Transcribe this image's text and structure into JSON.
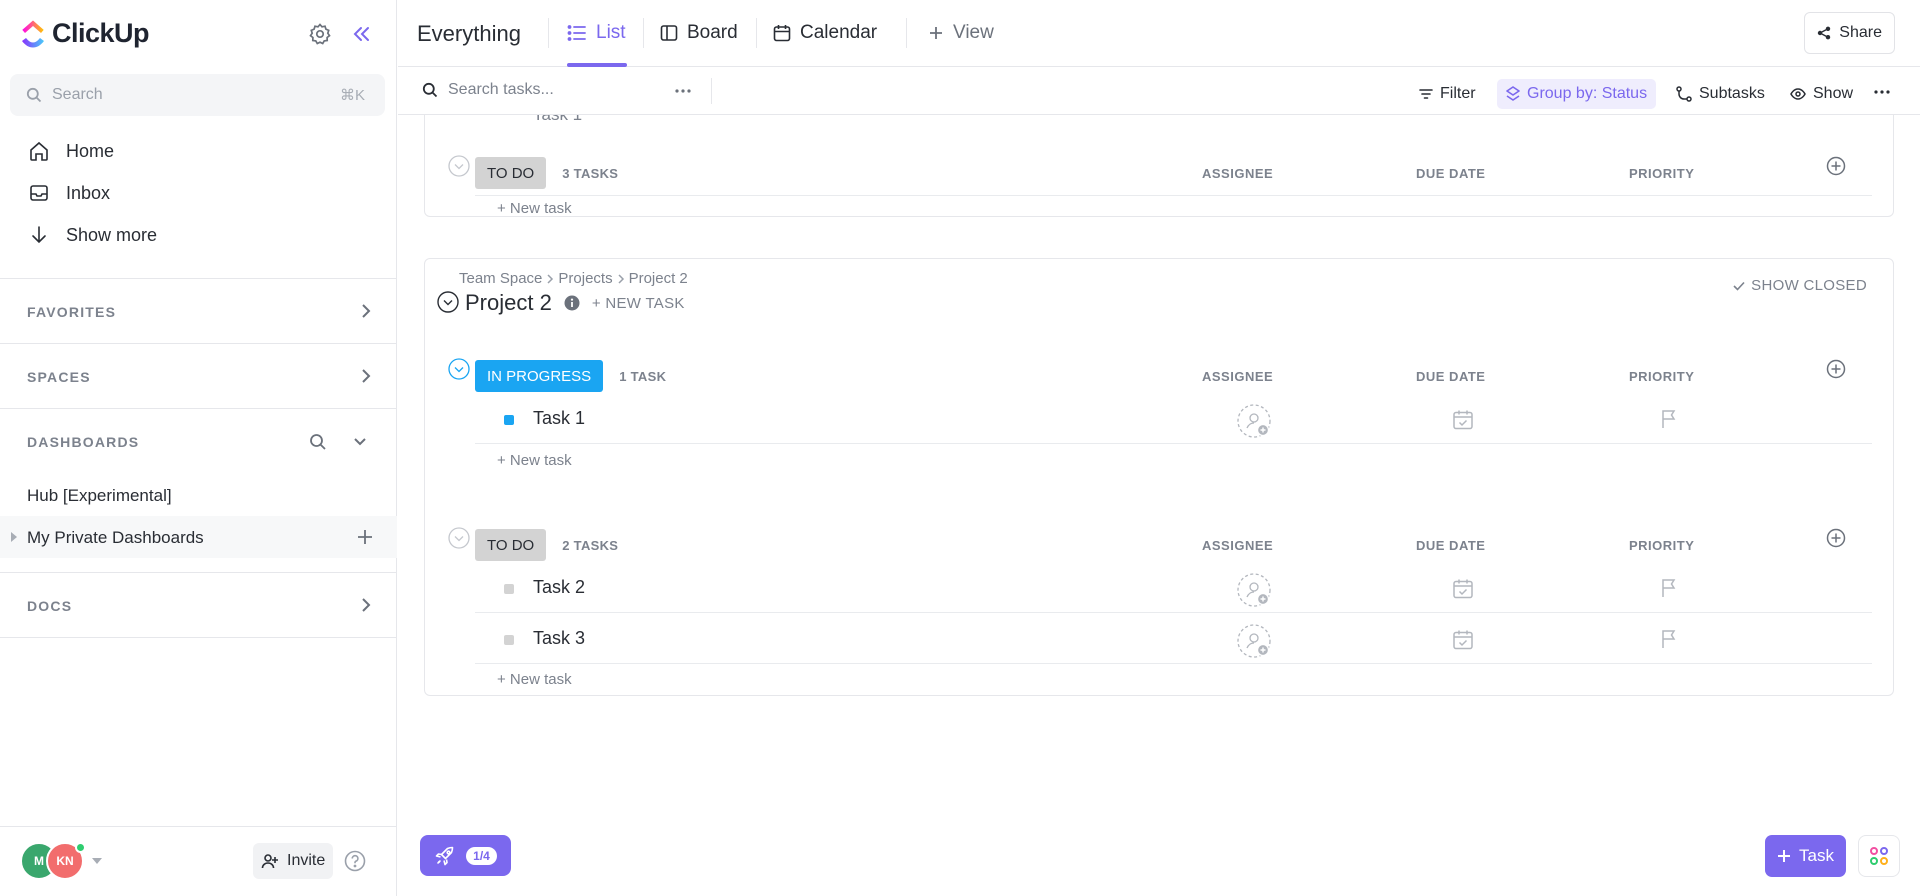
{
  "brand": {
    "name": "ClickUp",
    "colors": {
      "accent": "#7b68ee",
      "in_progress": "#1aa5f2",
      "todo": "#d3d3d3"
    }
  },
  "sidebar": {
    "search": {
      "placeholder": "Search",
      "shortcut": "⌘K"
    },
    "nav": [
      {
        "label": "Home",
        "icon": "home-icon"
      },
      {
        "label": "Inbox",
        "icon": "inbox-icon"
      },
      {
        "label": "Show more",
        "icon": "arrow-down-icon"
      }
    ],
    "sections": {
      "favorites": "FAVORITES",
      "spaces": "SPACES",
      "dashboards": "DASHBOARDS",
      "docs": "DOCS"
    },
    "dashboards": [
      "Hub [Experimental]",
      "My Private Dashboards"
    ],
    "footer": {
      "avatars": [
        "M",
        "KN"
      ],
      "invite_label": "Invite"
    }
  },
  "topbar": {
    "title": "Everything",
    "tabs": [
      {
        "label": "List",
        "icon": "list-icon",
        "active": true
      },
      {
        "label": "Board",
        "icon": "board-icon",
        "active": false
      },
      {
        "label": "Calendar",
        "icon": "calendar-icon",
        "active": false
      }
    ],
    "add_view_label": "View",
    "share_label": "Share"
  },
  "toolbar": {
    "search_placeholder": "Search tasks...",
    "filter_label": "Filter",
    "group_label": "Group by: Status",
    "subtasks_label": "Subtasks",
    "show_label": "Show"
  },
  "columns": {
    "assignee": "ASSIGNEE",
    "due_date": "DUE DATE",
    "priority": "PRIORITY"
  },
  "partial_task_label": "Task 1",
  "new_task_label": "+ New task",
  "lists": [
    {
      "groups": [
        {
          "status": "TO DO",
          "count": "3 TASKS",
          "tasks": []
        }
      ]
    },
    {
      "breadcrumb": [
        "Team Space",
        "Projects",
        "Project 2"
      ],
      "title": "Project 2",
      "new_task_label": "+ NEW TASK",
      "show_closed_label": "SHOW CLOSED",
      "groups": [
        {
          "status": "IN PROGRESS",
          "count": "1 TASK",
          "tasks": [
            "Task 1"
          ]
        },
        {
          "status": "TO DO",
          "count": "2 TASKS",
          "tasks": [
            "Task 2",
            "Task 3"
          ]
        }
      ]
    }
  ],
  "bottom": {
    "onboarding_progress": "1/4",
    "new_task_button": "Task"
  }
}
